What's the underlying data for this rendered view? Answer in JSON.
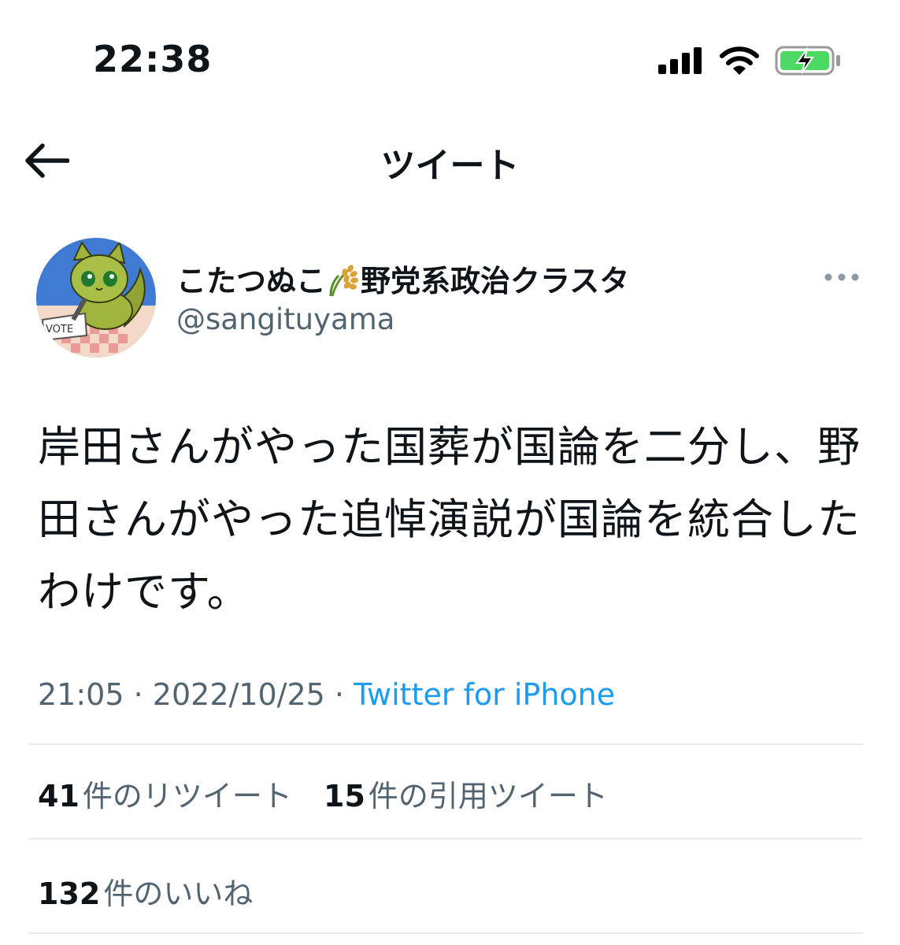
{
  "status_bar": {
    "time": "22:38"
  },
  "nav": {
    "title": "ツイート"
  },
  "tweet": {
    "author_name_part1": "こたつぬこ",
    "author_name_part2": "野党系政治クラスタ",
    "handle": "@sangituyama",
    "avatar_label": "VOTE",
    "text": "岸田さんがやった国葬が国論を二分し、野田さんがやった追悼演説が国論を統合したわけです。",
    "time": "21:05",
    "date": "2022/10/25",
    "separator": "·",
    "source": "Twitter for iPhone"
  },
  "stats": {
    "retweets_count": "41",
    "retweets_label": "件のリツイート",
    "quotes_count": "15",
    "quotes_label": "件の引用ツイート",
    "likes_count": "132",
    "likes_label": "件のいいね"
  },
  "colors": {
    "link": "#1d9bf0",
    "muted": "#536471",
    "battery": "#4cd964"
  },
  "icons": [
    "signal-icon",
    "wifi-icon",
    "battery-charging-icon",
    "back-arrow-icon",
    "rice-emoji-icon",
    "more-icon"
  ]
}
